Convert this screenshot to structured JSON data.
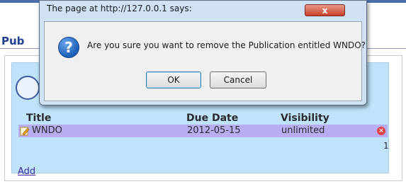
{
  "page": {
    "title": "Pub"
  },
  "table": {
    "headers": [
      "Title",
      "Due Date",
      "Visibility"
    ],
    "rows": [
      {
        "title": "WNDO",
        "due_date": "2012-05-15",
        "visibility": "unlimited"
      }
    ],
    "page_number": "1",
    "add_link": "Add"
  },
  "dialog": {
    "title": "The page at http://127.0.0.1 says:",
    "close_label": "x",
    "message": "Are you sure you want to remove the Publication entitled WNDO?",
    "ok_label": "OK",
    "cancel_label": "Cancel"
  },
  "colors": {
    "panel_bg": "#bfe3f9",
    "row_highlight": "#b6aef0",
    "link": "#3d2a9e",
    "close_button": "#c7412a"
  }
}
